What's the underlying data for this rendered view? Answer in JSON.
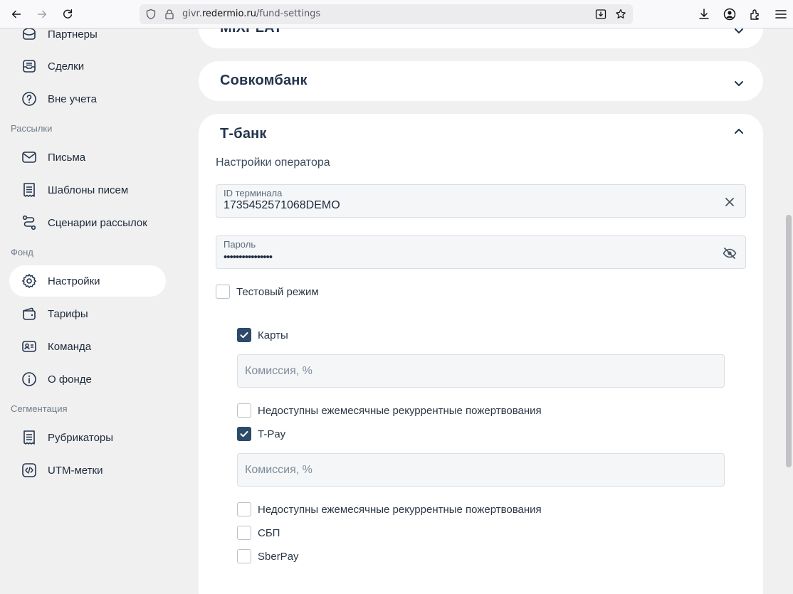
{
  "browser": {
    "url_prefix": "givr.",
    "url_domain": "redermio.ru",
    "url_path": "/fund-settings"
  },
  "sidebar": {
    "items_top": [
      {
        "label": "Партнеры",
        "icon": "partners-icon"
      },
      {
        "label": "Сделки",
        "icon": "deals-icon"
      },
      {
        "label": "Вне учета",
        "icon": "question-icon"
      }
    ],
    "section_mailings": "Рассылки",
    "items_mailings": [
      {
        "label": "Письма",
        "icon": "mail-icon"
      },
      {
        "label": "Шаблоны писем",
        "icon": "templates-icon"
      },
      {
        "label": "Сценарии рассылок",
        "icon": "scenario-icon"
      }
    ],
    "section_fund": "Фонд",
    "items_fund": [
      {
        "label": "Настройки",
        "icon": "gear-icon",
        "active": true
      },
      {
        "label": "Тарифы",
        "icon": "wallet-icon"
      },
      {
        "label": "Команда",
        "icon": "team-icon"
      },
      {
        "label": "О фонде",
        "icon": "info-icon"
      }
    ],
    "section_segmentation": "Сегментация",
    "items_segmentation": [
      {
        "label": "Рубрикаторы",
        "icon": "rubric-icon"
      },
      {
        "label": "UTM-метки",
        "icon": "code-icon"
      }
    ]
  },
  "main": {
    "mixplat_title": "MIXPLAT",
    "sovcombank_title": "Совкомбанк",
    "tbank": {
      "title": "Т-банк",
      "operator_settings": "Настройки оператора",
      "terminal_id_label": "ID терминала",
      "terminal_id_value": "1735452571068DEMO",
      "password_label": "Пароль",
      "password_value": "••••••••••••••••",
      "test_mode_label": "Тестовый режим",
      "test_mode_checked": false,
      "methods": {
        "cards_label": "Карты",
        "cards_checked": true,
        "cards_commission_placeholder": "Комиссия, %",
        "cards_no_recurrent_label": "Недоступны ежемесячные рекуррентные пожертвования",
        "tpay_label": "T-Pay",
        "tpay_checked": true,
        "tpay_commission_placeholder": "Комиссия, %",
        "tpay_no_recurrent_label": "Недоступны ежемесячные рекуррентные пожертвования",
        "sbp_label": "СБП",
        "sberpay_label": "SberPay"
      }
    }
  },
  "colors": {
    "accent": "#2c4a6a",
    "page_bg": "#f0f0f0",
    "card_bg": "#ffffff"
  }
}
